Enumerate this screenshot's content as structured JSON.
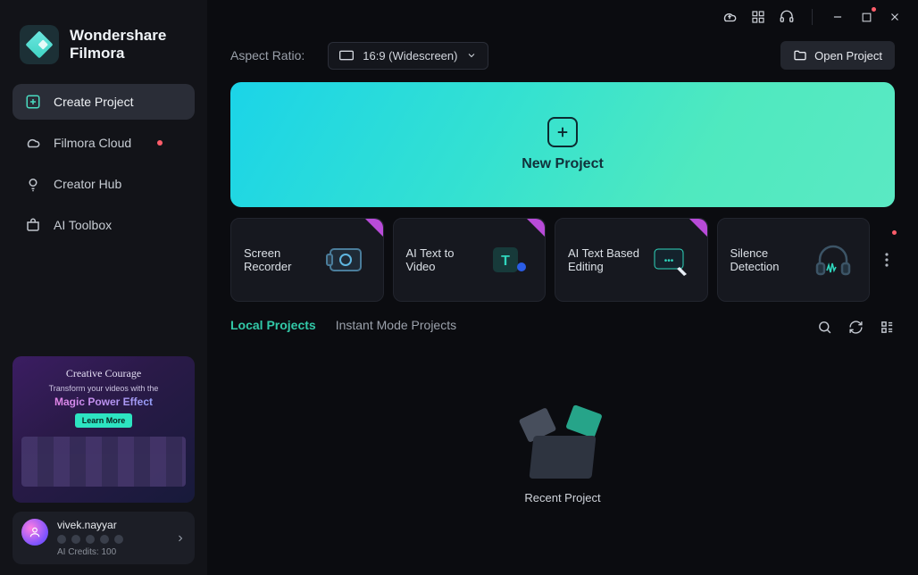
{
  "brand": {
    "line1": "Wondershare",
    "line2": "Filmora"
  },
  "nav": {
    "create": "Create Project",
    "cloud": "Filmora Cloud",
    "hub": "Creator Hub",
    "toolbox": "AI Toolbox"
  },
  "promo": {
    "script": "Creative Courage",
    "tagline": "Transform your videos with the",
    "headline": "Magic Power Effect",
    "cta": "Learn More"
  },
  "account": {
    "name": "vivek.nayyar",
    "credits": "AI Credits: 100"
  },
  "toolbar": {
    "aspect_label": "Aspect Ratio:",
    "aspect_value": "16:9 (Widescreen)",
    "open_project": "Open Project"
  },
  "hero": {
    "label": "New Project"
  },
  "cards": {
    "screen_recorder": "Screen Recorder",
    "ai_text_to_video": "AI Text to Video",
    "ai_text_based_editing": "AI Text Based Editing",
    "silence_detection": "Silence Detection"
  },
  "tabs": {
    "local": "Local Projects",
    "instant": "Instant Mode Projects"
  },
  "recent": {
    "label": "Recent Project"
  }
}
